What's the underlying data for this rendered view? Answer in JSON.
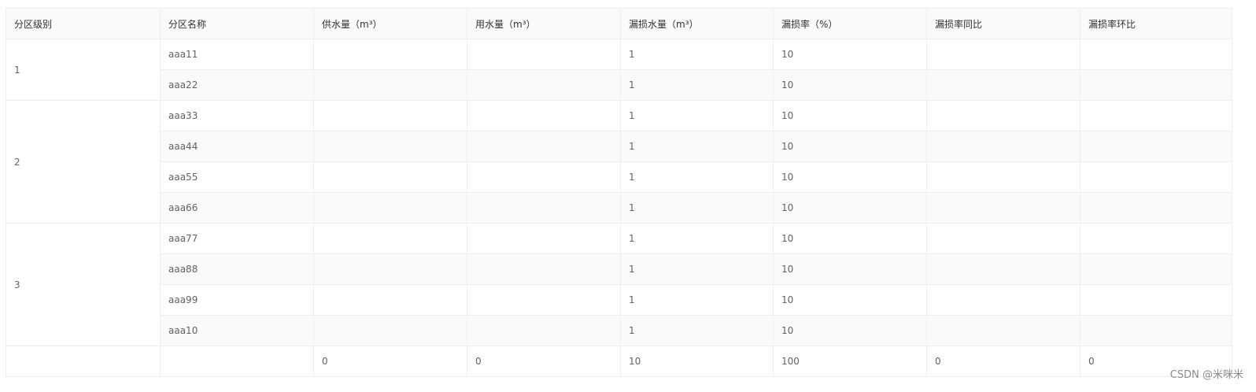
{
  "table": {
    "columns": [
      "分区级别",
      "分区名称",
      "供水量（m³）",
      "用水量（m³）",
      "漏损水量（m³）",
      "漏损率（%）",
      "漏损率同比",
      "漏损率环比"
    ],
    "groups": [
      {
        "level": "1",
        "rows": [
          [
            "aaa11",
            "",
            "",
            "1",
            "10",
            "",
            ""
          ],
          [
            "aaa22",
            "",
            "",
            "1",
            "10",
            "",
            ""
          ]
        ]
      },
      {
        "level": "2",
        "rows": [
          [
            "aaa33",
            "",
            "",
            "1",
            "10",
            "",
            ""
          ],
          [
            "aaa44",
            "",
            "",
            "1",
            "10",
            "",
            ""
          ],
          [
            "aaa55",
            "",
            "",
            "1",
            "10",
            "",
            ""
          ],
          [
            "aaa66",
            "",
            "",
            "1",
            "10",
            "",
            ""
          ]
        ]
      },
      {
        "level": "3",
        "rows": [
          [
            "aaa77",
            "",
            "",
            "1",
            "10",
            "",
            ""
          ],
          [
            "aaa88",
            "",
            "",
            "1",
            "10",
            "",
            ""
          ],
          [
            "aaa99",
            "",
            "",
            "1",
            "10",
            "",
            ""
          ],
          [
            "aaa10",
            "",
            "",
            "1",
            "10",
            "",
            ""
          ]
        ]
      }
    ],
    "summary": [
      "",
      "",
      "0",
      "0",
      "10",
      "100",
      "0",
      "0"
    ]
  },
  "watermark": "CSDN @米咪米"
}
